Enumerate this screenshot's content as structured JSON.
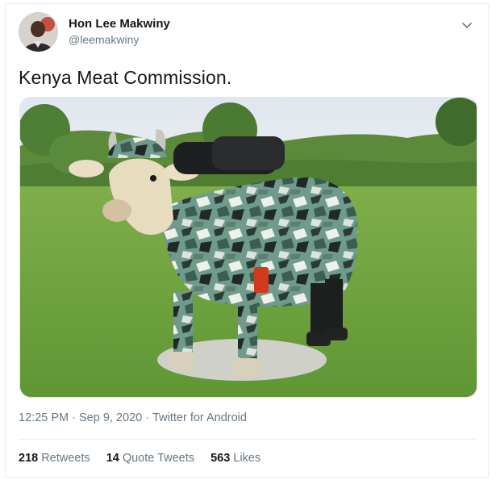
{
  "user": {
    "name": "Hon Lee Makwiny",
    "handle": "@leemakwiny"
  },
  "tweet": {
    "text": "Kenya Meat Commission.",
    "time": "12:25 PM",
    "separator": "·",
    "date": "Sep 9, 2020",
    "source": "Twitter for Android"
  },
  "stats": {
    "retweets_count": "218",
    "retweets_label": "Retweets",
    "quote_count": "14",
    "quote_label": "Quote Tweets",
    "likes_count": "563",
    "likes_label": "Likes"
  },
  "icons": {
    "caret": "chevron-down-icon"
  },
  "colors": {
    "text_primary": "#14171a",
    "text_secondary": "#657786",
    "border": "#e6ecf0"
  }
}
